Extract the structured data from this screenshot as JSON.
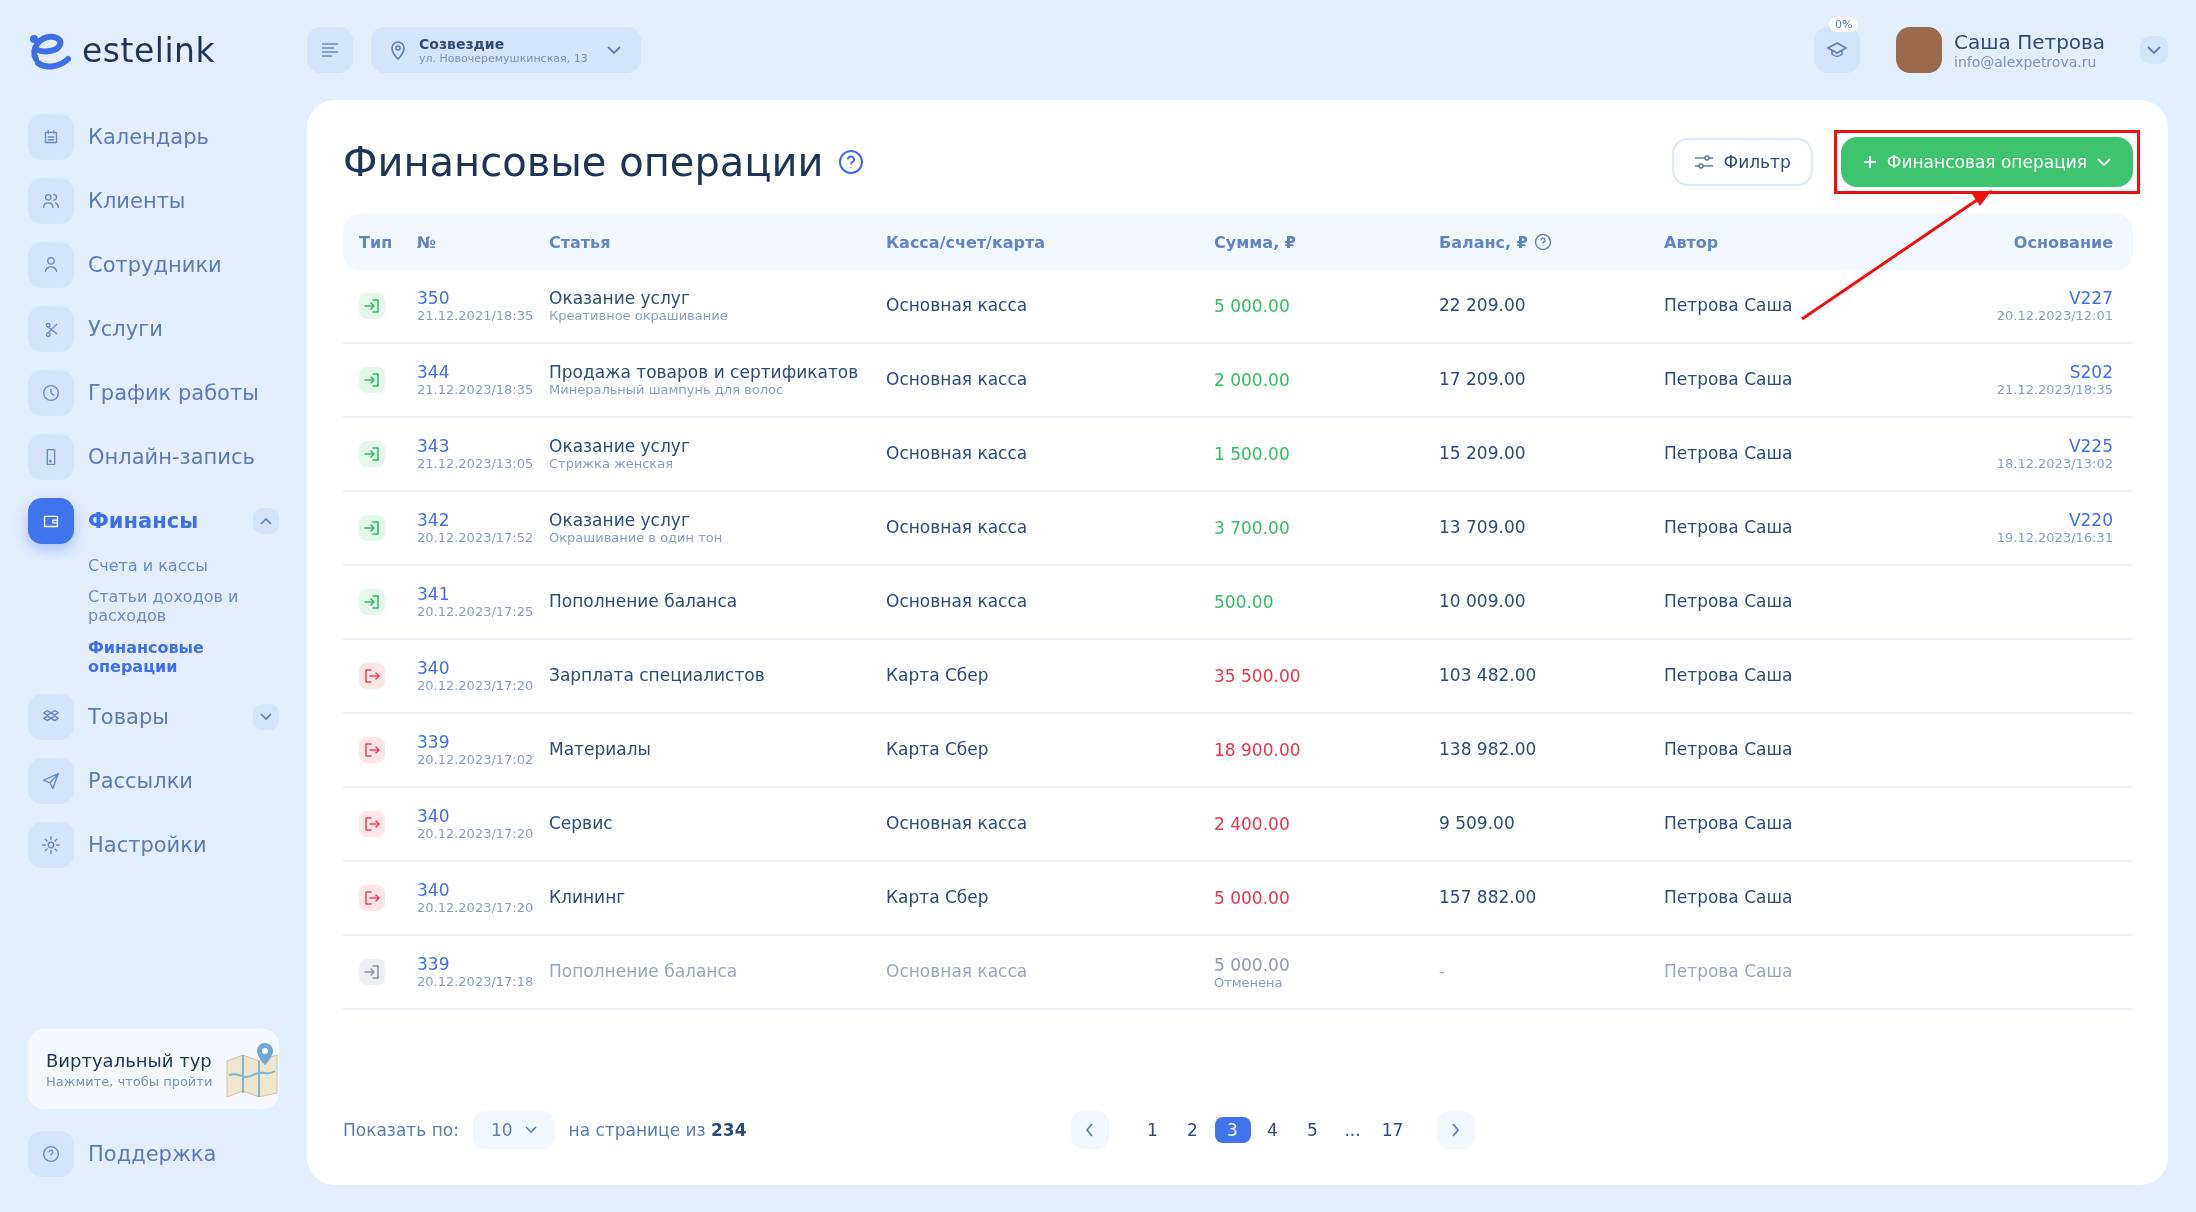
{
  "brand": {
    "name": "estelink"
  },
  "location": {
    "name": "Созвездие",
    "address": "ул. Новочеремушкинская, 13"
  },
  "progress_badge": "0%",
  "user": {
    "name": "Саша Петрова",
    "email": "info@alexpetrova.ru"
  },
  "sidebar": {
    "items": [
      {
        "label": "Календарь",
        "selected": false
      },
      {
        "label": "Клиенты",
        "selected": false
      },
      {
        "label": "Сотрудники",
        "selected": false
      },
      {
        "label": "Услуги",
        "selected": false
      },
      {
        "label": "График работы",
        "selected": false
      },
      {
        "label": "Онлайн-запись",
        "selected": false
      },
      {
        "label": "Финансы",
        "selected": true,
        "expanded": true,
        "children": [
          {
            "label": "Счета и кассы",
            "selected": false
          },
          {
            "label": "Статьи доходов и расходов",
            "selected": false
          },
          {
            "label": "Финансовые операции",
            "selected": true
          }
        ]
      },
      {
        "label": "Товары",
        "selected": false,
        "expanded": false
      },
      {
        "label": "Рассылки",
        "selected": false
      },
      {
        "label": "Настройки",
        "selected": false
      }
    ],
    "tour": {
      "title": "Виртуальный тур",
      "subtitle": "Нажмите, чтобы пройти"
    },
    "support": "Поддержка"
  },
  "page": {
    "title": "Финансовые операции",
    "filter_button": "Фильтр",
    "add_button": "Финансовая операция"
  },
  "table": {
    "columns": [
      "Тип",
      "№",
      "Статья",
      "Касса/счет/карта",
      "Сумма, ₽",
      "Баланс, ₽",
      "Автор",
      "Основание"
    ],
    "rows": [
      {
        "kind": "income",
        "number": "350",
        "datetime": "21.12.2021/18:35",
        "article": "Оказание услуг",
        "article_note": "Креативное окрашивание",
        "account": "Основная касса",
        "amount": "5 000.00",
        "balance": "22 209.00",
        "author": "Петрова Саша",
        "basis": "V227",
        "basis_datetime": "20.12.2023/12:01"
      },
      {
        "kind": "income",
        "number": "344",
        "datetime": "21.12.2023/18:35",
        "article": "Продажа товаров и сертификатов",
        "article_note": "Минеральный шампунь для волос",
        "account": "Основная касса",
        "amount": "2 000.00",
        "balance": "17 209.00",
        "author": "Петрова Саша",
        "basis": "S202",
        "basis_datetime": "21.12.2023/18:35"
      },
      {
        "kind": "income",
        "number": "343",
        "datetime": "21.12.2023/13:05",
        "article": "Оказание услуг",
        "article_note": "Стрижка женская",
        "account": "Основная касса",
        "amount": "1 500.00",
        "balance": "15 209.00",
        "author": "Петрова Саша",
        "basis": "V225",
        "basis_datetime": "18.12.2023/13:02"
      },
      {
        "kind": "income",
        "number": "342",
        "datetime": "20.12.2023/17:52",
        "article": "Оказание услуг",
        "article_note": "Окрашивание в один тон",
        "account": "Основная касса",
        "amount": "3 700.00",
        "balance": "13 709.00",
        "author": "Петрова Саша",
        "basis": "V220",
        "basis_datetime": "19.12.2023/16:31"
      },
      {
        "kind": "income",
        "number": "341",
        "datetime": "20.12.2023/17:25",
        "article": "Пополнение баланса",
        "account": "Основная касса",
        "amount": "500.00",
        "balance": "10 009.00",
        "author": "Петрова Саша"
      },
      {
        "kind": "expense",
        "number": "340",
        "datetime": "20.12.2023/17:20",
        "article": "Зарплата специалистов",
        "account": "Карта Сбер",
        "amount": "35 500.00",
        "balance": "103 482.00",
        "author": "Петрова Саша"
      },
      {
        "kind": "expense",
        "number": "339",
        "datetime": "20.12.2023/17:02",
        "article": "Материалы",
        "account": "Карта Сбер",
        "amount": "18 900.00",
        "balance": "138 982.00",
        "author": "Петрова Саша"
      },
      {
        "kind": "expense",
        "number": "340",
        "datetime": "20.12.2023/17:20",
        "article": "Сервис",
        "account": "Основная касса",
        "amount": "2 400.00",
        "balance": "9 509.00",
        "author": "Петрова Саша"
      },
      {
        "kind": "expense",
        "number": "340",
        "datetime": "20.12.2023/17:20",
        "article": "Клининг",
        "account": "Карта Сбер",
        "amount": "5 000.00",
        "balance": "157 882.00",
        "author": "Петрова Саша"
      },
      {
        "kind": "cancelled",
        "number": "339",
        "datetime": "20.12.2023/17:18",
        "article": "Пополнение баланса",
        "account": "Основная касса",
        "amount": "5 000.00",
        "status": "Отменена",
        "balance": "-",
        "author": "Петрова Саша"
      }
    ]
  },
  "footer": {
    "show_label": "Показать по:",
    "page_size": "10",
    "total_prefix": "на странице из",
    "total": "234",
    "pages": [
      {
        "label": "1",
        "selected": false
      },
      {
        "label": "2",
        "selected": false
      },
      {
        "label": "3",
        "selected": true
      },
      {
        "label": "4",
        "selected": false
      },
      {
        "label": "5",
        "selected": false
      },
      {
        "label": "...",
        "selected": false
      },
      {
        "label": "17",
        "selected": false
      }
    ]
  }
}
